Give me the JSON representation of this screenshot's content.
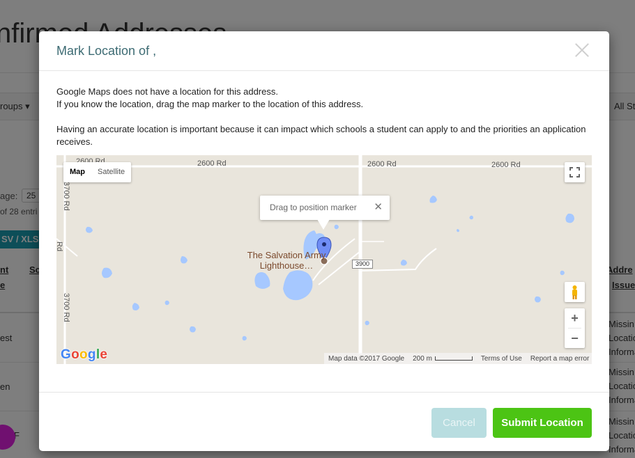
{
  "background": {
    "title": "nfirmed Addresses",
    "groups_label": "roups ▾",
    "all_label": "All St",
    "page_label": "age:",
    "page_value": "25",
    "entries_text": "of 28 entri",
    "export_label": "SV / XLS",
    "columns": {
      "left": "nt",
      "left2": "e",
      "mid": "Sc",
      "right": "Addre",
      "right2": "Issue"
    },
    "rows": [
      {
        "name": "est",
        "issue": [
          "Missin",
          "Locatio",
          "Informa"
        ]
      },
      {
        "name": "en",
        "issue": [
          "Missin",
          "Locatio",
          "Informa"
        ]
      },
      {
        "name": "F",
        "issue": [
          "Missin",
          "Locatio",
          "Informa"
        ]
      }
    ]
  },
  "modal": {
    "title": "Mark Location of ,",
    "message_line1": "Google Maps does not have a location for this address.",
    "message_line2": "If you know the location, drag the map marker to the location of this address.",
    "message_line3": "Having an accurate location is important because it can impact which schools a student can apply to and the priorities an application receives.",
    "cancel_label": "Cancel",
    "submit_label": "Submit Location"
  },
  "map": {
    "map_type_map": "Map",
    "map_type_satellite": "Satellite",
    "road_2600_a": "2600 Rd",
    "road_2600_b": "2600 Rd",
    "road_2600_c": "2600 Rd",
    "road_2600_d": "2600 Rd",
    "road_3700_top": "3700 Rd",
    "road_3700": "3700 Rd",
    "road_diag": "Rd",
    "route_badge": "3900",
    "infowindow_text": "Drag to position marker",
    "infowindow_close": "✕",
    "poi_name": "The Salvation Army Lighthouse…",
    "zoom_in": "+",
    "zoom_out": "−",
    "google_logo": "Google",
    "attribution": "Map data ©2017 Google",
    "scale": "200 m",
    "terms": "Terms of Use",
    "report": "Report a map error",
    "colors": {
      "land": "#e9e5dc",
      "water": "#a6c8ff",
      "road": "#ffffff",
      "marker": "#6f8df5"
    }
  }
}
